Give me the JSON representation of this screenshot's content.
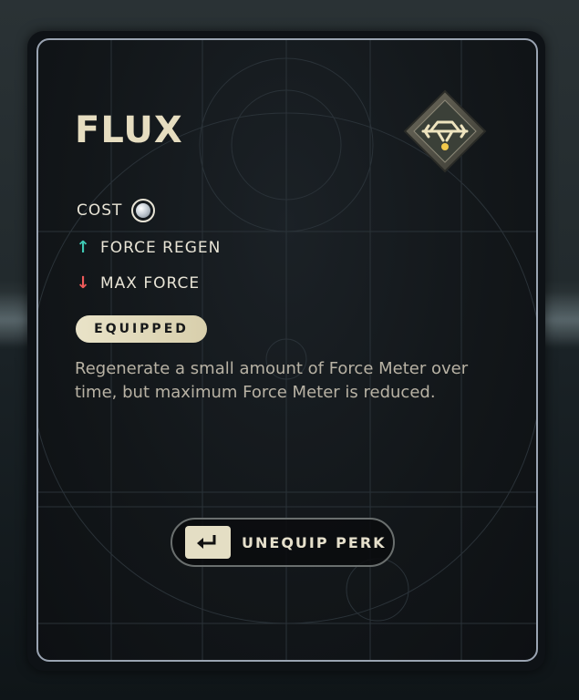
{
  "perk": {
    "name": "FLUX",
    "icon": "flux-rune-icon",
    "cost_label": "COST",
    "cost_icon": "force-orb-icon",
    "stats": [
      {
        "direction": "up",
        "icon": "arrow-up-icon",
        "label": "FORCE REGEN",
        "color": "#3fc9b4"
      },
      {
        "direction": "down",
        "icon": "arrow-down-icon",
        "label": "MAX FORCE",
        "color": "#ee5a5a"
      }
    ],
    "status": "EQUIPPED",
    "description": "Regenerate a small amount of Force Meter over time, but maximum Force Meter is reduced."
  },
  "action": {
    "label": "UNEQUIP PERK",
    "key_icon": "enter-key-icon"
  },
  "colors": {
    "title": "#e6ddc0",
    "badge": "#e9e3c8",
    "positive": "#3fc9b4",
    "negative": "#ee5a5a"
  }
}
